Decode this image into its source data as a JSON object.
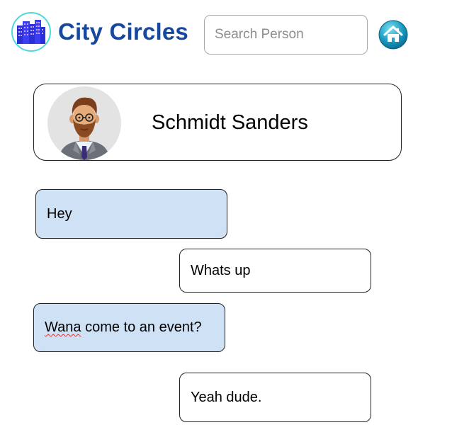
{
  "header": {
    "app_title": "City Circles",
    "logo_icon": "city-buildings-icon",
    "search": {
      "placeholder": "Search Person",
      "value": ""
    },
    "home_icon": "home-icon"
  },
  "profile": {
    "name": "Schmidt Sanders",
    "avatar_icon": "bearded-man-avatar"
  },
  "messages": [
    {
      "text": "Hey",
      "direction": "received"
    },
    {
      "text": "Whats up",
      "direction": "sent"
    },
    {
      "text_start": "Wana",
      "text_rest": " come to an event?",
      "direction": "received"
    },
    {
      "text": "Yeah dude.",
      "direction": "sent"
    }
  ],
  "colors": {
    "brand": "#1748a0",
    "received_bubble": "#cfe1f4",
    "sent_bubble": "#ffffff",
    "logo_ring": "#4fd7e0"
  }
}
